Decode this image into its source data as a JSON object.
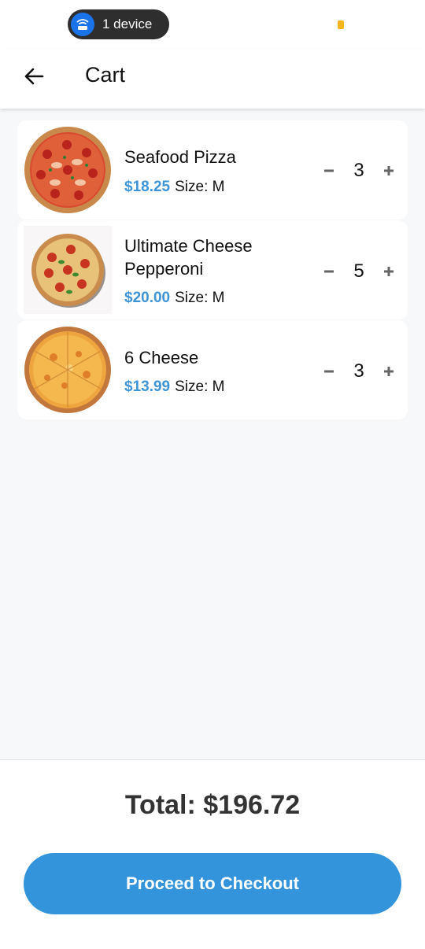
{
  "status_bar": {
    "device_label": "1 device",
    "wifi_icon": "wifi-router-icon",
    "indicator_color": "#f6b51b"
  },
  "app_bar": {
    "back_icon": "arrow-left-icon",
    "title": "Cart"
  },
  "cart": {
    "items": [
      {
        "name": "Seafood Pizza",
        "price": "$18.25",
        "size": "Size: M",
        "quantity": "3",
        "image": "seafood-pizza"
      },
      {
        "name": "Ultimate Cheese Pepperoni",
        "price": "$20.00",
        "size": "Size: M",
        "quantity": "5",
        "image": "cheese-pepperoni-pizza"
      },
      {
        "name": "6 Cheese",
        "price": "$13.99",
        "size": "Size: M",
        "quantity": "3",
        "image": "six-cheese-pizza"
      }
    ]
  },
  "footer": {
    "total": "Total: $196.72",
    "checkout_label": "Proceed to Checkout"
  },
  "colors": {
    "accent": "#3394dc",
    "price": "#3d94d6",
    "background": "#f7f8fa"
  }
}
